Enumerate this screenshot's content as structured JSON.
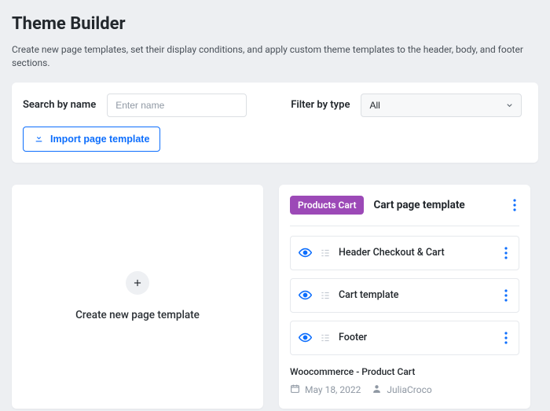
{
  "page": {
    "title": "Theme Builder",
    "description": "Create new page templates, set their display conditions, and apply custom theme templates to the header, body, and footer sections."
  },
  "filter": {
    "search_label": "Search by name",
    "search_placeholder": "Enter name",
    "type_label": "Filter by type",
    "type_value": "All",
    "import_label": "Import page template"
  },
  "create_tile": {
    "label": "Create new page template"
  },
  "template": {
    "badge": "Products Cart",
    "title": "Cart page template",
    "parts": [
      {
        "name": "Header Checkout & Cart"
      },
      {
        "name": "Cart template"
      },
      {
        "name": "Footer"
      }
    ],
    "path": "Woocommerce - Product Cart",
    "date": "May 18, 2022",
    "author": "JuliaCroco"
  }
}
